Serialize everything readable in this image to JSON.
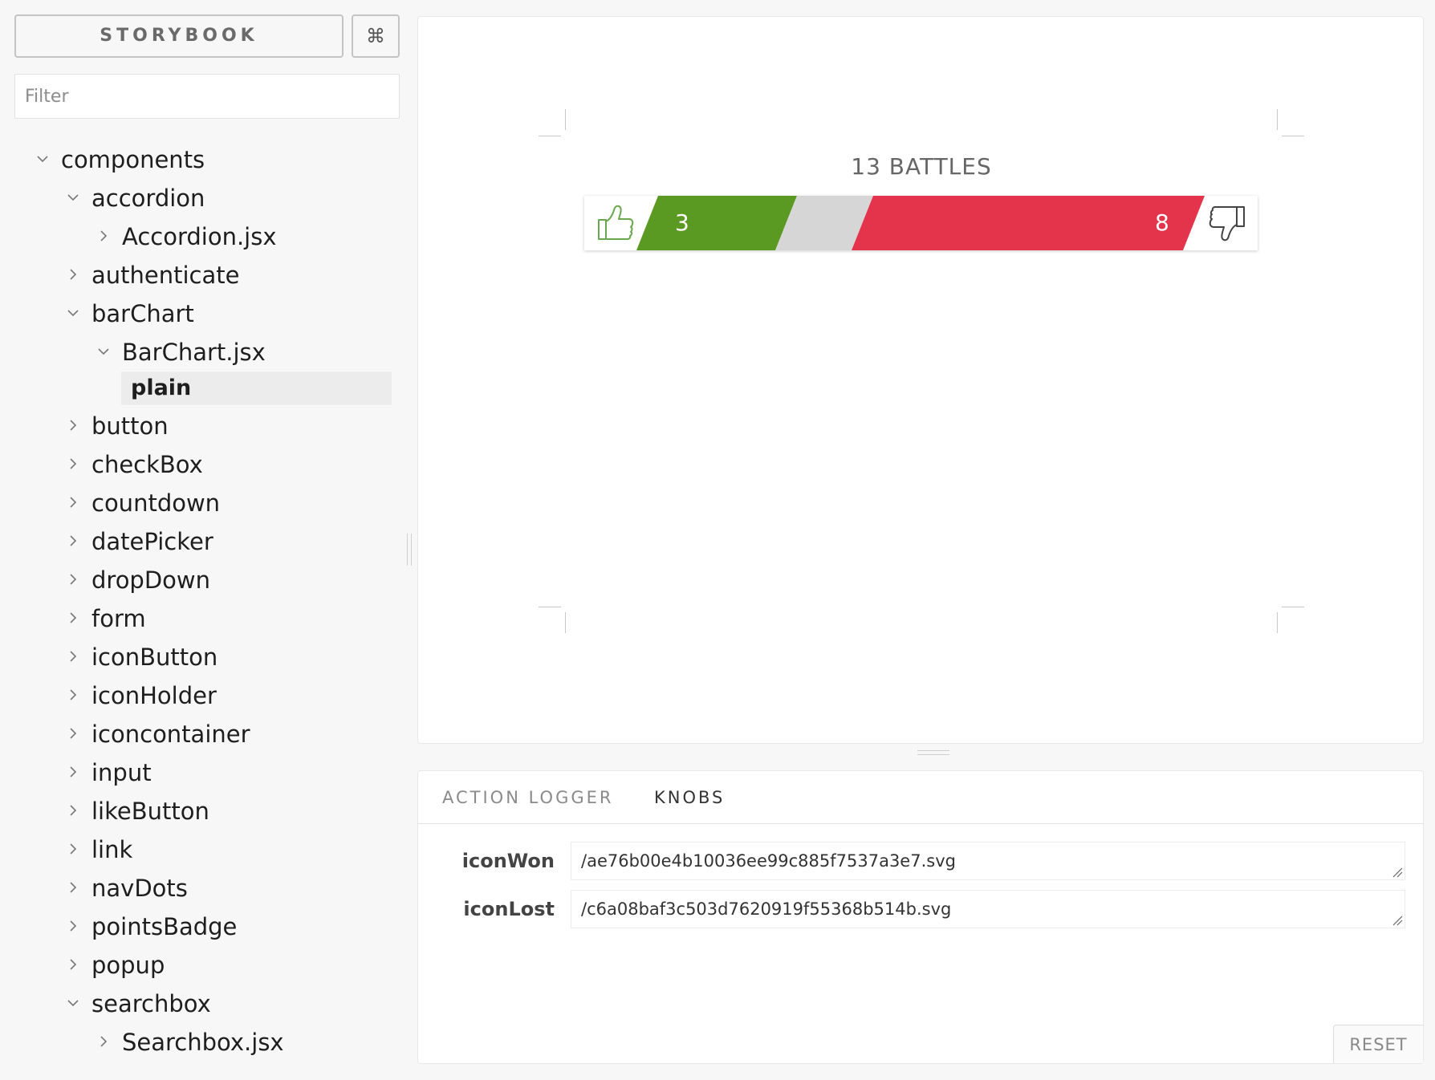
{
  "sidebar": {
    "brand_label": "STORYBOOK",
    "shortcut_icon": "⌘",
    "filter_placeholder": "Filter",
    "tree": [
      {
        "label": "components",
        "depth": 0,
        "expanded": true
      },
      {
        "label": "accordion",
        "depth": 1,
        "expanded": true
      },
      {
        "label": "Accordion.jsx",
        "depth": 2,
        "expanded": false
      },
      {
        "label": "authenticate",
        "depth": 1,
        "expanded": false
      },
      {
        "label": "barChart",
        "depth": 1,
        "expanded": true
      },
      {
        "label": "BarChart.jsx",
        "depth": 2,
        "expanded": true
      },
      {
        "label": "plain",
        "depth": 3,
        "selected": true
      },
      {
        "label": "button",
        "depth": 1,
        "expanded": false
      },
      {
        "label": "checkBox",
        "depth": 1,
        "expanded": false
      },
      {
        "label": "countdown",
        "depth": 1,
        "expanded": false
      },
      {
        "label": "datePicker",
        "depth": 1,
        "expanded": false
      },
      {
        "label": "dropDown",
        "depth": 1,
        "expanded": false
      },
      {
        "label": "form",
        "depth": 1,
        "expanded": false
      },
      {
        "label": "iconButton",
        "depth": 1,
        "expanded": false
      },
      {
        "label": "iconHolder",
        "depth": 1,
        "expanded": false
      },
      {
        "label": "iconcontainer",
        "depth": 1,
        "expanded": false
      },
      {
        "label": "input",
        "depth": 1,
        "expanded": false
      },
      {
        "label": "likeButton",
        "depth": 1,
        "expanded": false
      },
      {
        "label": "link",
        "depth": 1,
        "expanded": false
      },
      {
        "label": "navDots",
        "depth": 1,
        "expanded": false
      },
      {
        "label": "pointsBadge",
        "depth": 1,
        "expanded": false
      },
      {
        "label": "popup",
        "depth": 1,
        "expanded": false
      },
      {
        "label": "searchbox",
        "depth": 1,
        "expanded": true
      },
      {
        "label": "Searchbox.jsx",
        "depth": 2,
        "expanded": false
      }
    ]
  },
  "preview": {
    "title": "13 BATTLES",
    "won_count": "3",
    "lost_count": "8",
    "won_icon": "thumbs-up-icon",
    "lost_icon": "thumbs-down-icon",
    "colors": {
      "won": "#5a9a23",
      "draw": "#d6d6d6",
      "lost": "#e3344b",
      "won_icon": "#6aa84f",
      "lost_icon": "#444444"
    }
  },
  "addons": {
    "tabs": [
      {
        "label": "ACTION LOGGER",
        "active": false
      },
      {
        "label": "KNOBS",
        "active": true
      }
    ],
    "knobs": [
      {
        "label": "iconWon",
        "value": "/ae76b00e4b10036ee99c885f7537a3e7.svg"
      },
      {
        "label": "iconLost",
        "value": "/c6a08baf3c503d7620919f55368b514b.svg"
      }
    ],
    "reset_label": "RESET"
  }
}
